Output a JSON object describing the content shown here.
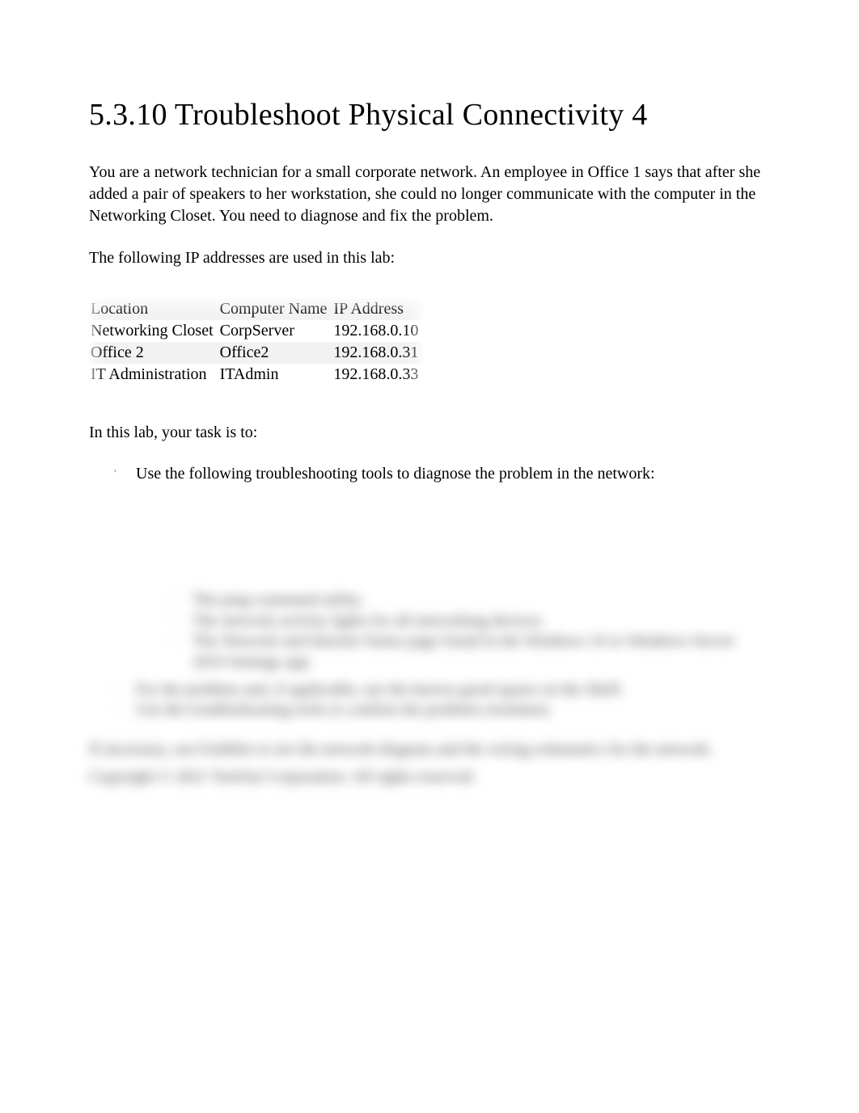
{
  "title": "5.3.10 Troubleshoot Physical Connectivity 4",
  "intro": "You are a network technician for a small corporate network. An employee in Office 1 says that after she added a pair of speakers to her workstation, she could no longer communicate with the computer in the Networking Closet. You need to diagnose and fix the problem.",
  "lead": "The following IP addresses are used in this lab:",
  "table": {
    "headers": {
      "c0": "Location",
      "c1": "Computer Name",
      "c2": "IP Address"
    },
    "rows": [
      {
        "c0": "Networking Closet",
        "c1": "CorpServer",
        "c2": "192.168.0.10"
      },
      {
        "c0": "Office 2",
        "c1": "Office2",
        "c2": "192.168.0.31"
      },
      {
        "c0": "IT Administration",
        "c1": "ITAdmin",
        "c2": "192.168.0.33"
      }
    ]
  },
  "taskLead": "In this lab, your task is to:",
  "tasks": {
    "item0": "Use the following troubleshooting tools to diagnose the problem in the network:"
  },
  "hidden": {
    "sub0": "The ping command utility.",
    "sub1": "The network activity lights for all networking devices.",
    "sub2": "The Network and Internet Status page found in the Windows 10 or Windows Server 2019 Settings app.",
    "mid0": "Fix the problem and, if applicable, use the known good spares on the Shelf.",
    "mid1": "Use the troubleshooting tools to confirm the problem resolution.",
    "para0": "If necessary, use Exhibits to see the network diagram and the wiring schematics for the network.",
    "para1": "Copyright © 2021 TestOut Corporation. All rights reserved."
  }
}
